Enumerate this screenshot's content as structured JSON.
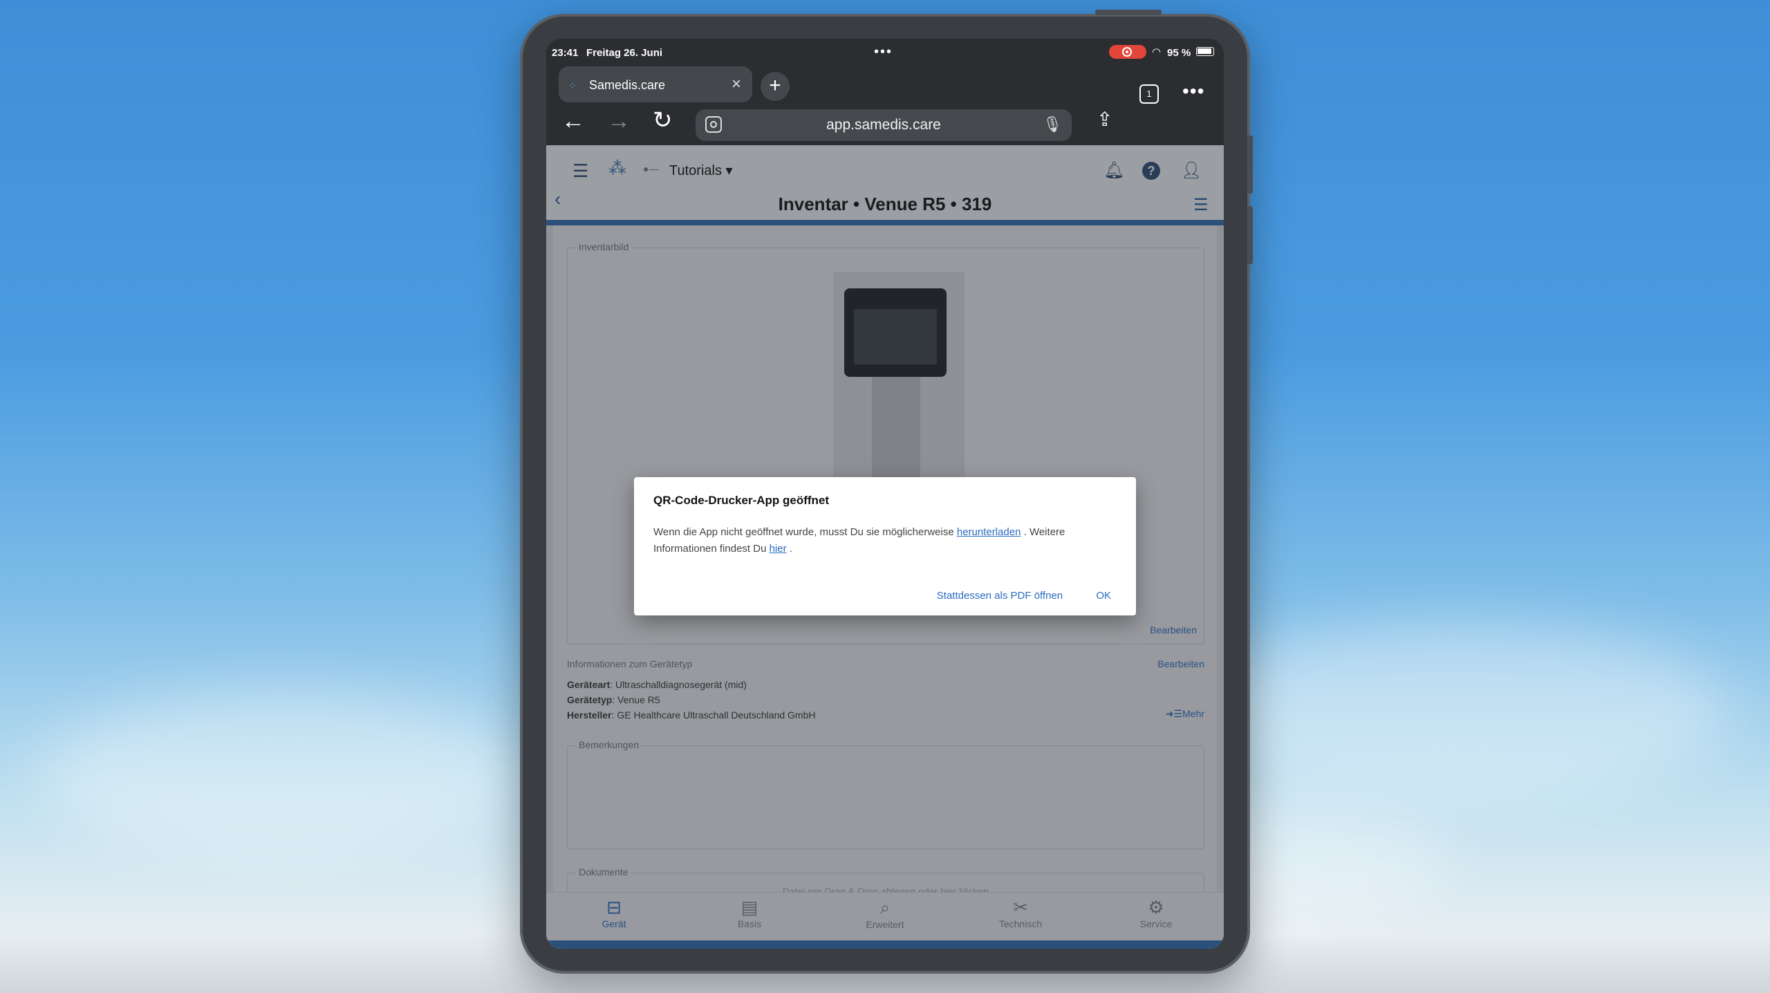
{
  "status_bar": {
    "time": "23:41",
    "date": "Freitag 26. Juni",
    "battery": "95 %"
  },
  "browser": {
    "tab_title": "Samedis.care",
    "url": "app.samedis.care",
    "tabs_count": "1"
  },
  "app": {
    "tenant": "Tutorials",
    "page_title": "Inventar • Venue R5 • 319",
    "image_section": {
      "legend": "Inventarbild",
      "edit": "Bearbeiten"
    },
    "device_type_section": {
      "heading": "Informationen zum Gerätetyp",
      "edit": "Bearbeiten",
      "rows": [
        {
          "label": "Geräteart",
          "value": "Ultraschalldiagnosegerät (mid)"
        },
        {
          "label": "Gerätetyp",
          "value": "Venue R5"
        },
        {
          "label": "Hersteller",
          "value": "GE Healthcare Ultraschall Deutschland GmbH"
        }
      ],
      "more": "Mehr"
    },
    "remarks": {
      "legend": "Bemerkungen"
    },
    "documents": {
      "legend": "Dokumente",
      "dropzone": "Datei per Drag & Drop ablegen oder hier klicken"
    },
    "bottom_nav": [
      {
        "label": "Gerät",
        "icon": "device-icon",
        "active": true
      },
      {
        "label": "Basis",
        "icon": "id-card-icon",
        "active": false
      },
      {
        "label": "Erweitert",
        "icon": "search-doc-icon",
        "active": false
      },
      {
        "label": "Technisch",
        "icon": "tools-icon",
        "active": false
      },
      {
        "label": "Service",
        "icon": "service-icon",
        "active": false
      }
    ]
  },
  "dialog": {
    "title": "QR-Code-Drucker-App geöffnet",
    "body_part1": "Wenn die App nicht geöffnet wurde, musst Du sie möglicherweise ",
    "link_download": "herunterladen",
    "body_part2": " . Weitere Informationen findest Du ",
    "link_here": "hier",
    "body_part3": " .",
    "btn_pdf": "Stattdessen als PDF öffnen",
    "btn_ok": "OK"
  },
  "colors": {
    "accent": "#2a6cc0",
    "recording": "#e2463a",
    "app_blue": "#2b6cb0"
  }
}
